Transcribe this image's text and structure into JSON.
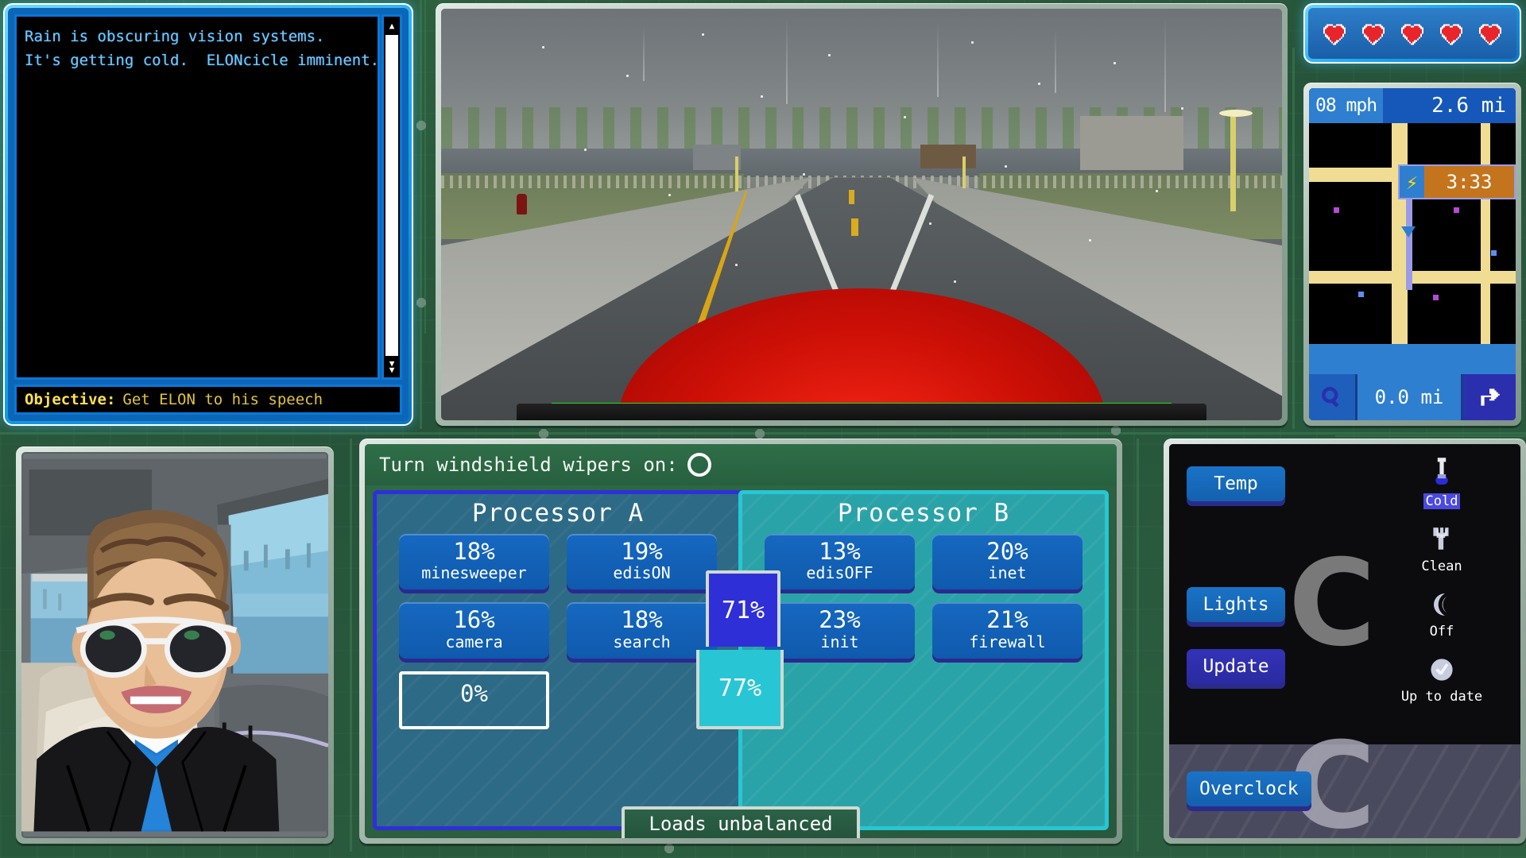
{
  "console": {
    "lines": [
      "Rain is obscuring vision systems.",
      "It's getting cold.  ELONcicle imminent."
    ],
    "scroll_up_icon": "scroll-up-arrow",
    "scroll_down_icon": "scroll-down-arrow"
  },
  "objective": {
    "key": "Objective:",
    "value": "Get ELON to his speech"
  },
  "health": {
    "hearts": 5,
    "heart_color": "#e8252a"
  },
  "gps": {
    "speed": "08 mph",
    "distance": "2.6 mi",
    "eta": "3:33",
    "bolt_icon": "lightning-bolt-icon",
    "zoom_icon": "magnifier-icon",
    "next_turn_distance": "0.0 mi",
    "turn_icon": "turn-right-arrow-icon"
  },
  "wipers": {
    "label": "Turn windshield wipers on:",
    "state": "off"
  },
  "processors": [
    {
      "name": "Processor A",
      "load": "71%",
      "accent": "#2f2fd8",
      "tiles": [
        {
          "pct": "18%",
          "name": "minesweeper"
        },
        {
          "pct": "19%",
          "name": "edisON"
        },
        {
          "pct": "16%",
          "name": "camera"
        },
        {
          "pct": "18%",
          "name": "search"
        }
      ],
      "empty_slot": "0%"
    },
    {
      "name": "Processor B",
      "load": "77%",
      "accent": "#28c6d4",
      "tiles": [
        {
          "pct": "13%",
          "name": "edisOFF"
        },
        {
          "pct": "20%",
          "name": "inet"
        },
        {
          "pct": "23%",
          "name": "init"
        },
        {
          "pct": "21%",
          "name": "firewall"
        }
      ]
    }
  ],
  "loads_banner": "Loads unbalanced",
  "controls": {
    "buttons": [
      {
        "label": "Temp",
        "style": "blue"
      },
      {
        "label": "Lights",
        "style": "blue"
      },
      {
        "label": "Update",
        "style": "purple"
      },
      {
        "label": "Overclock",
        "style": "blue"
      }
    ],
    "status": [
      {
        "icon": "thermometer-icon",
        "label": "Cold",
        "highlighted": true
      },
      {
        "icon": "wrench-icon",
        "label": "Clean",
        "highlighted": false
      },
      {
        "icon": "moon-icon",
        "label": "Off",
        "highlighted": false
      },
      {
        "icon": "check-circle-icon",
        "label": "Up to date",
        "highlighted": false
      }
    ]
  }
}
